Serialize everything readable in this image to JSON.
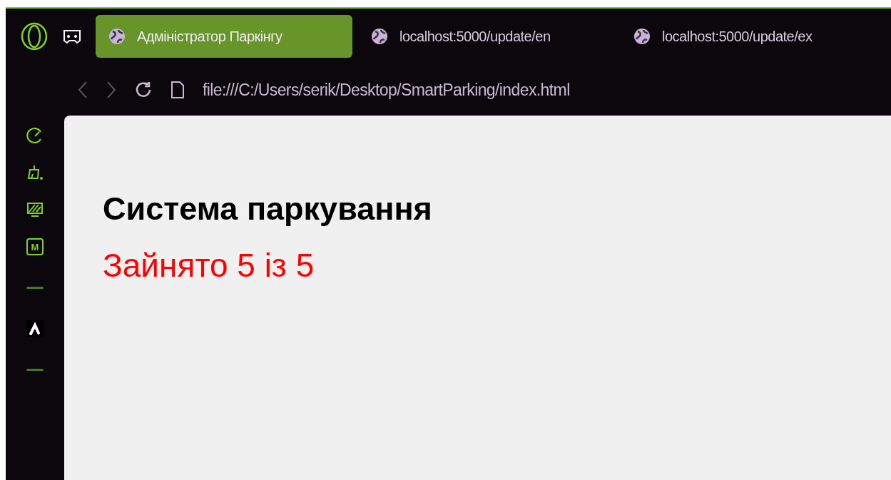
{
  "tabs": [
    {
      "label": "Адміністратор Паркінгу",
      "selected": true
    },
    {
      "label": "localhost:5000/update/en",
      "selected": false
    },
    {
      "label": "localhost:5000/update/ex",
      "selected": false
    }
  ],
  "address_bar": {
    "url": "file:///C:/Users/serik/Desktop/SmartParking/index.html"
  },
  "sidebar": {
    "items": [
      {
        "kind": "speed"
      },
      {
        "kind": "cleaner"
      },
      {
        "kind": "wallpaper"
      },
      {
        "kind": "chip",
        "label": "M"
      },
      {
        "kind": "divider"
      },
      {
        "kind": "app"
      },
      {
        "kind": "divider"
      }
    ]
  },
  "page": {
    "heading": "Система паркування",
    "status": "Зайнято 5 із 5",
    "full": true
  }
}
